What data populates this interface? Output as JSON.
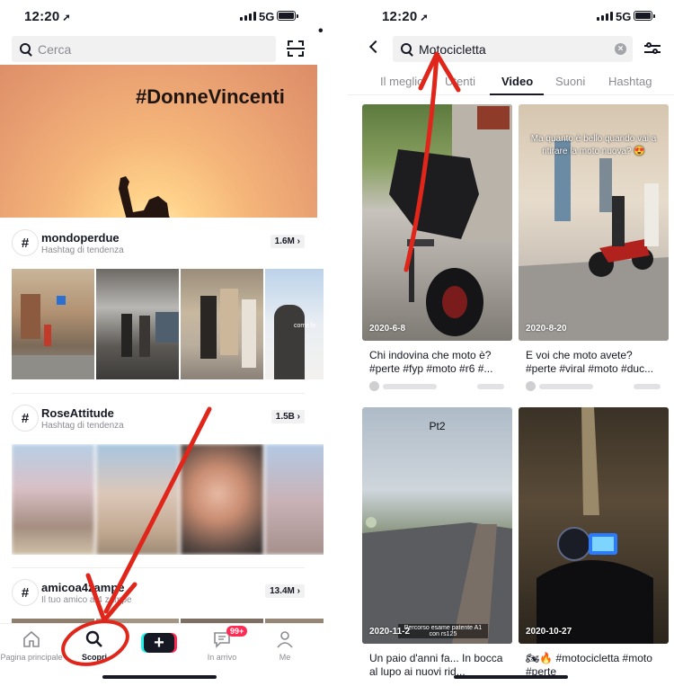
{
  "left": {
    "status": {
      "time": "12:20",
      "network": "5G"
    },
    "search": {
      "placeholder": "Cerca"
    },
    "banner": {
      "title": "#DonneVincenti"
    },
    "sections": [
      {
        "tag": "mondoperdue",
        "subtitle": "Hashtag di tendenza",
        "count": "1.6M"
      },
      {
        "tag": "RoseAttitude",
        "subtitle": "Hashtag di tendenza",
        "count": "1.5B"
      },
      {
        "tag": "amicoa4zampe",
        "subtitle": "Il tuo amico a 4 zampe",
        "count": "13.4M"
      }
    ],
    "thumb_caption": "come le",
    "tabbar": {
      "home": "Pagina principale",
      "discover": "Scopri",
      "inbox": "In arrivo",
      "inbox_badge": "99+",
      "me": "Me"
    }
  },
  "right": {
    "status": {
      "time": "12:20",
      "network": "5G"
    },
    "search": {
      "query": "Motocicletta"
    },
    "tabs": [
      "Il meglio",
      "Utenti",
      "Video",
      "Suoni",
      "Hashtag"
    ],
    "active_tab": "Video",
    "videos": [
      {
        "date": "2020-6-8",
        "caption": "Chi indovina che moto è? #perte #fyp #moto #r6 #..."
      },
      {
        "date": "2020-8-20",
        "caption": "E voi che moto avete? #perte #viral #moto #duc...",
        "overlay": "Ma quanto è bello quando vai a ritirare la moto nuova? 😍"
      },
      {
        "date": "2020-11-2",
        "caption": "Un paio d'anni fa... In bocca al lupo ai nuovi rid...",
        "overlay_top": "Pt2",
        "overlay_bottom": "Percorso esame patente A1 con rs125"
      },
      {
        "date": "2020-10-27",
        "caption": "🏍🔥 #motocicletta #moto #perte"
      }
    ]
  },
  "colors": {
    "accent": "#fe2c55",
    "cyan": "#25f4ee",
    "annotation": "#e0261b"
  }
}
